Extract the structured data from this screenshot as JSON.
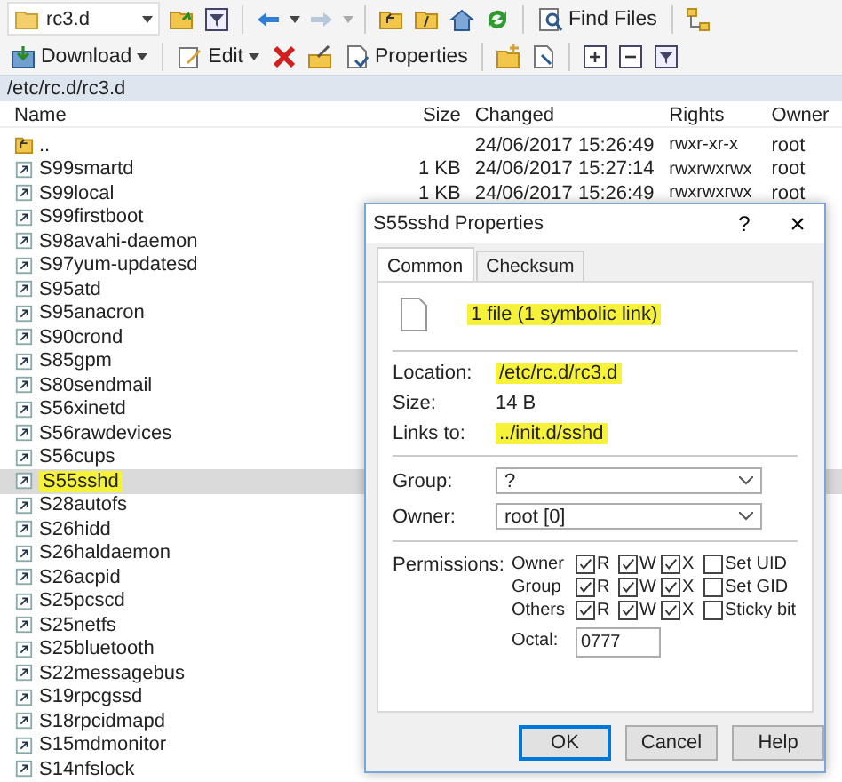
{
  "toolbar": {
    "folder": "rc3.d",
    "find_files": "Find Files"
  },
  "toolbar2": {
    "download": "Download",
    "edit": "Edit",
    "properties": "Properties"
  },
  "path": "/etc/rc.d/rc3.d",
  "columns": [
    "Name",
    "Size",
    "Changed",
    "Rights",
    "Owner"
  ],
  "rows": [
    {
      "kind": "parent",
      "name": "..",
      "size": "",
      "changed": "24/06/2017 15:26:49",
      "rights": "rwxr-xr-x",
      "owner": "root",
      "selected": false,
      "highlighted": false
    },
    {
      "kind": "link",
      "name": "S99smartd",
      "size": "1 KB",
      "changed": "24/06/2017 15:27:14",
      "rights": "rwxrwxrwx",
      "owner": "root",
      "selected": false,
      "highlighted": false
    },
    {
      "kind": "link",
      "name": "S99local",
      "size": "1 KB",
      "changed": "24/06/2017 15:26:49",
      "rights": "rwxrwxrwx",
      "owner": "root",
      "selected": false,
      "highlighted": false
    },
    {
      "kind": "link",
      "name": "S99firstboot",
      "selected": false,
      "highlighted": false
    },
    {
      "kind": "link",
      "name": "S98avahi-daemon",
      "selected": false,
      "highlighted": false
    },
    {
      "kind": "link",
      "name": "S97yum-updatesd",
      "selected": false,
      "highlighted": false
    },
    {
      "kind": "link",
      "name": "S95atd",
      "selected": false,
      "highlighted": false
    },
    {
      "kind": "link",
      "name": "S95anacron",
      "selected": false,
      "highlighted": false
    },
    {
      "kind": "link",
      "name": "S90crond",
      "selected": false,
      "highlighted": false
    },
    {
      "kind": "link",
      "name": "S85gpm",
      "selected": false,
      "highlighted": false
    },
    {
      "kind": "link",
      "name": "S80sendmail",
      "selected": false,
      "highlighted": false
    },
    {
      "kind": "link",
      "name": "S56xinetd",
      "selected": false,
      "highlighted": false
    },
    {
      "kind": "link",
      "name": "S56rawdevices",
      "selected": false,
      "highlighted": false
    },
    {
      "kind": "link",
      "name": "S56cups",
      "selected": false,
      "highlighted": false
    },
    {
      "kind": "link",
      "name": "S55sshd",
      "selected": true,
      "highlighted": true
    },
    {
      "kind": "link",
      "name": "S28autofs",
      "selected": false,
      "highlighted": false
    },
    {
      "kind": "link",
      "name": "S26hidd",
      "selected": false,
      "highlighted": false
    },
    {
      "kind": "link",
      "name": "S26haldaemon",
      "selected": false,
      "highlighted": false
    },
    {
      "kind": "link",
      "name": "S26acpid",
      "selected": false,
      "highlighted": false
    },
    {
      "kind": "link",
      "name": "S25pcscd",
      "selected": false,
      "highlighted": false
    },
    {
      "kind": "link",
      "name": "S25netfs",
      "selected": false,
      "highlighted": false
    },
    {
      "kind": "link",
      "name": "S25bluetooth",
      "selected": false,
      "highlighted": false
    },
    {
      "kind": "link",
      "name": "S22messagebus",
      "selected": false,
      "highlighted": false
    },
    {
      "kind": "link",
      "name": "S19rpcgssd",
      "selected": false,
      "highlighted": false
    },
    {
      "kind": "link",
      "name": "S18rpcidmapd",
      "selected": false,
      "highlighted": false
    },
    {
      "kind": "link",
      "name": "S15mdmonitor",
      "selected": false,
      "highlighted": false
    },
    {
      "kind": "link",
      "name": "S14nfslock",
      "selected": false,
      "highlighted": false
    }
  ],
  "dialog": {
    "title": "S55sshd Properties",
    "help": "?",
    "close": "×",
    "tabs": [
      {
        "label": "Common",
        "selected": true
      },
      {
        "label": "Checksum",
        "selected": false
      }
    ],
    "summary": {
      "text": "1 file (1 symbolic link)",
      "highlighted": true
    },
    "info": [
      {
        "label": "Location:",
        "value": "/etc/rc.d/rc3.d",
        "highlighted": true
      },
      {
        "label": "Size:",
        "value": "14 B",
        "highlighted": false
      },
      {
        "label": "Links to:",
        "value": "../init.d/sshd",
        "highlighted": true
      }
    ],
    "group": {
      "label": "Group:",
      "value": "?"
    },
    "owner": {
      "label": "Owner:",
      "value": "root [0]"
    },
    "permissions_label": "Permissions:",
    "permissions": [
      {
        "label": "Owner",
        "r": {
          "label": "R",
          "checked": true
        },
        "w": {
          "label": "W",
          "checked": true
        },
        "x": {
          "label": "X",
          "checked": true
        },
        "special": {
          "label": "Set UID",
          "checked": false
        }
      },
      {
        "label": "Group",
        "r": {
          "label": "R",
          "checked": true
        },
        "w": {
          "label": "W",
          "checked": true
        },
        "x": {
          "label": "X",
          "checked": true
        },
        "special": {
          "label": "Set GID",
          "checked": false
        }
      },
      {
        "label": "Others",
        "r": {
          "label": "R",
          "checked": true
        },
        "w": {
          "label": "W",
          "checked": true
        },
        "x": {
          "label": "X",
          "checked": true
        },
        "special": {
          "label": "Sticky bit",
          "checked": false
        }
      }
    ],
    "octal": {
      "label": "Octal:",
      "value": "0777"
    },
    "buttons": [
      {
        "label": "OK",
        "default": true
      },
      {
        "label": "Cancel",
        "default": false
      },
      {
        "label": "Help",
        "default": false
      }
    ]
  }
}
